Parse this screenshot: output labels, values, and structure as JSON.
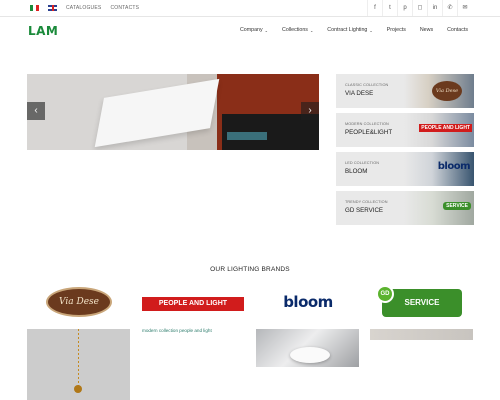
{
  "topbar": {
    "languages": [
      "Italiano",
      "English"
    ],
    "links": [
      "CATALOGUES",
      "CONTACTS"
    ],
    "social_icons": [
      "facebook-icon",
      "twitter-icon",
      "pinterest-icon",
      "instagram-icon",
      "linkedin-icon",
      "phone-icon",
      "mail-icon"
    ]
  },
  "header": {
    "logo": "LAM",
    "menu": [
      {
        "label": "Company",
        "dropdown": true
      },
      {
        "label": "Collections",
        "dropdown": true
      },
      {
        "label": "Contract Lighting",
        "dropdown": true
      },
      {
        "label": "Projects",
        "dropdown": false
      },
      {
        "label": "News",
        "dropdown": false
      },
      {
        "label": "Contacts",
        "dropdown": false
      }
    ]
  },
  "slider": {
    "prev_icon": "‹",
    "next_icon": "›"
  },
  "collections": [
    {
      "small": "CLASSIC COLLECTION",
      "big": "VIA DESE"
    },
    {
      "small": "MODERN COLLECTION",
      "big": "PEOPLE&LIGHT"
    },
    {
      "small": "LED COLLECTION",
      "big": "BLOOM"
    },
    {
      "small": "TRENDY COLLECTION",
      "big": "GD SERVICE"
    }
  ],
  "collection_tags": {
    "via_dese": "Via Dese",
    "people_light": "PEOPLE AND LIGHT",
    "bloom": "bloom",
    "gd_service": "SERVICE"
  },
  "brands": {
    "title": "OUR LIGHTING BRANDS",
    "via_dese": "Via Dese",
    "people_light": "PEOPLE AND LIGHT",
    "bloom": "bloom",
    "gd_service": "SERVICE",
    "gd_circle": "GD",
    "people_light_desc": "modern collection people and light"
  },
  "colors": {
    "brand_green": "#1a8a3a",
    "people_red": "#d11c1c",
    "bloom_blue": "#0a2a6a",
    "gd_green": "#3b8f2a"
  }
}
